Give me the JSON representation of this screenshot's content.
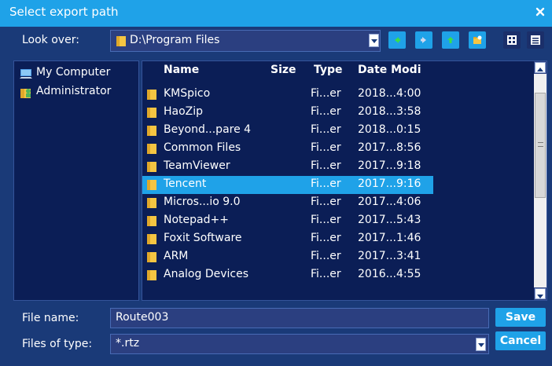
{
  "window": {
    "title": "Select export path"
  },
  "toolbar": {
    "look_over_label": "Look over:",
    "current_path": "D:\\Program Files"
  },
  "tree": [
    {
      "label": "My Computer",
      "icon": "computer-icon"
    },
    {
      "label": "Administrator",
      "icon": "user-folder-icon"
    }
  ],
  "file_list": {
    "columns": [
      "Name",
      "Size",
      "Type",
      "Date Modi"
    ],
    "rows": [
      {
        "name": "KMSpico",
        "type": "Fi...er",
        "date": "2018...4:00"
      },
      {
        "name": "HaoZip",
        "type": "Fi...er",
        "date": "2018...3:58"
      },
      {
        "name": "Beyond...pare 4",
        "type": "Fi...er",
        "date": "2018...0:15"
      },
      {
        "name": "Common Files",
        "type": "Fi...er",
        "date": "2017...8:56"
      },
      {
        "name": "TeamViewer",
        "type": "Fi...er",
        "date": "2017...9:18"
      },
      {
        "name": "Tencent",
        "type": "Fi...er",
        "date": "2017...9:16",
        "selected": true
      },
      {
        "name": "Micros...io 9.0",
        "type": "Fi...er",
        "date": "2017...4:06"
      },
      {
        "name": "Notepad++",
        "type": "Fi...er",
        "date": "2017...5:43"
      },
      {
        "name": "Foxit Software",
        "type": "Fi...er",
        "date": "2017...1:46"
      },
      {
        "name": "ARM",
        "type": "Fi...er",
        "date": "2017...3:41"
      },
      {
        "name": "Analog Devices",
        "type": "Fi...er",
        "date": "2016...4:55"
      }
    ]
  },
  "form": {
    "file_name_label": "File name:",
    "file_name_value": "Route003",
    "file_type_label": "Files of type:",
    "file_type_value": "*.rtz"
  },
  "buttons": {
    "save": "Save",
    "cancel": "Cancel"
  },
  "colors": {
    "accent": "#1fa2e8",
    "background": "#1a3a78",
    "panel": "#0b1e56",
    "folder": "#f5c542"
  }
}
